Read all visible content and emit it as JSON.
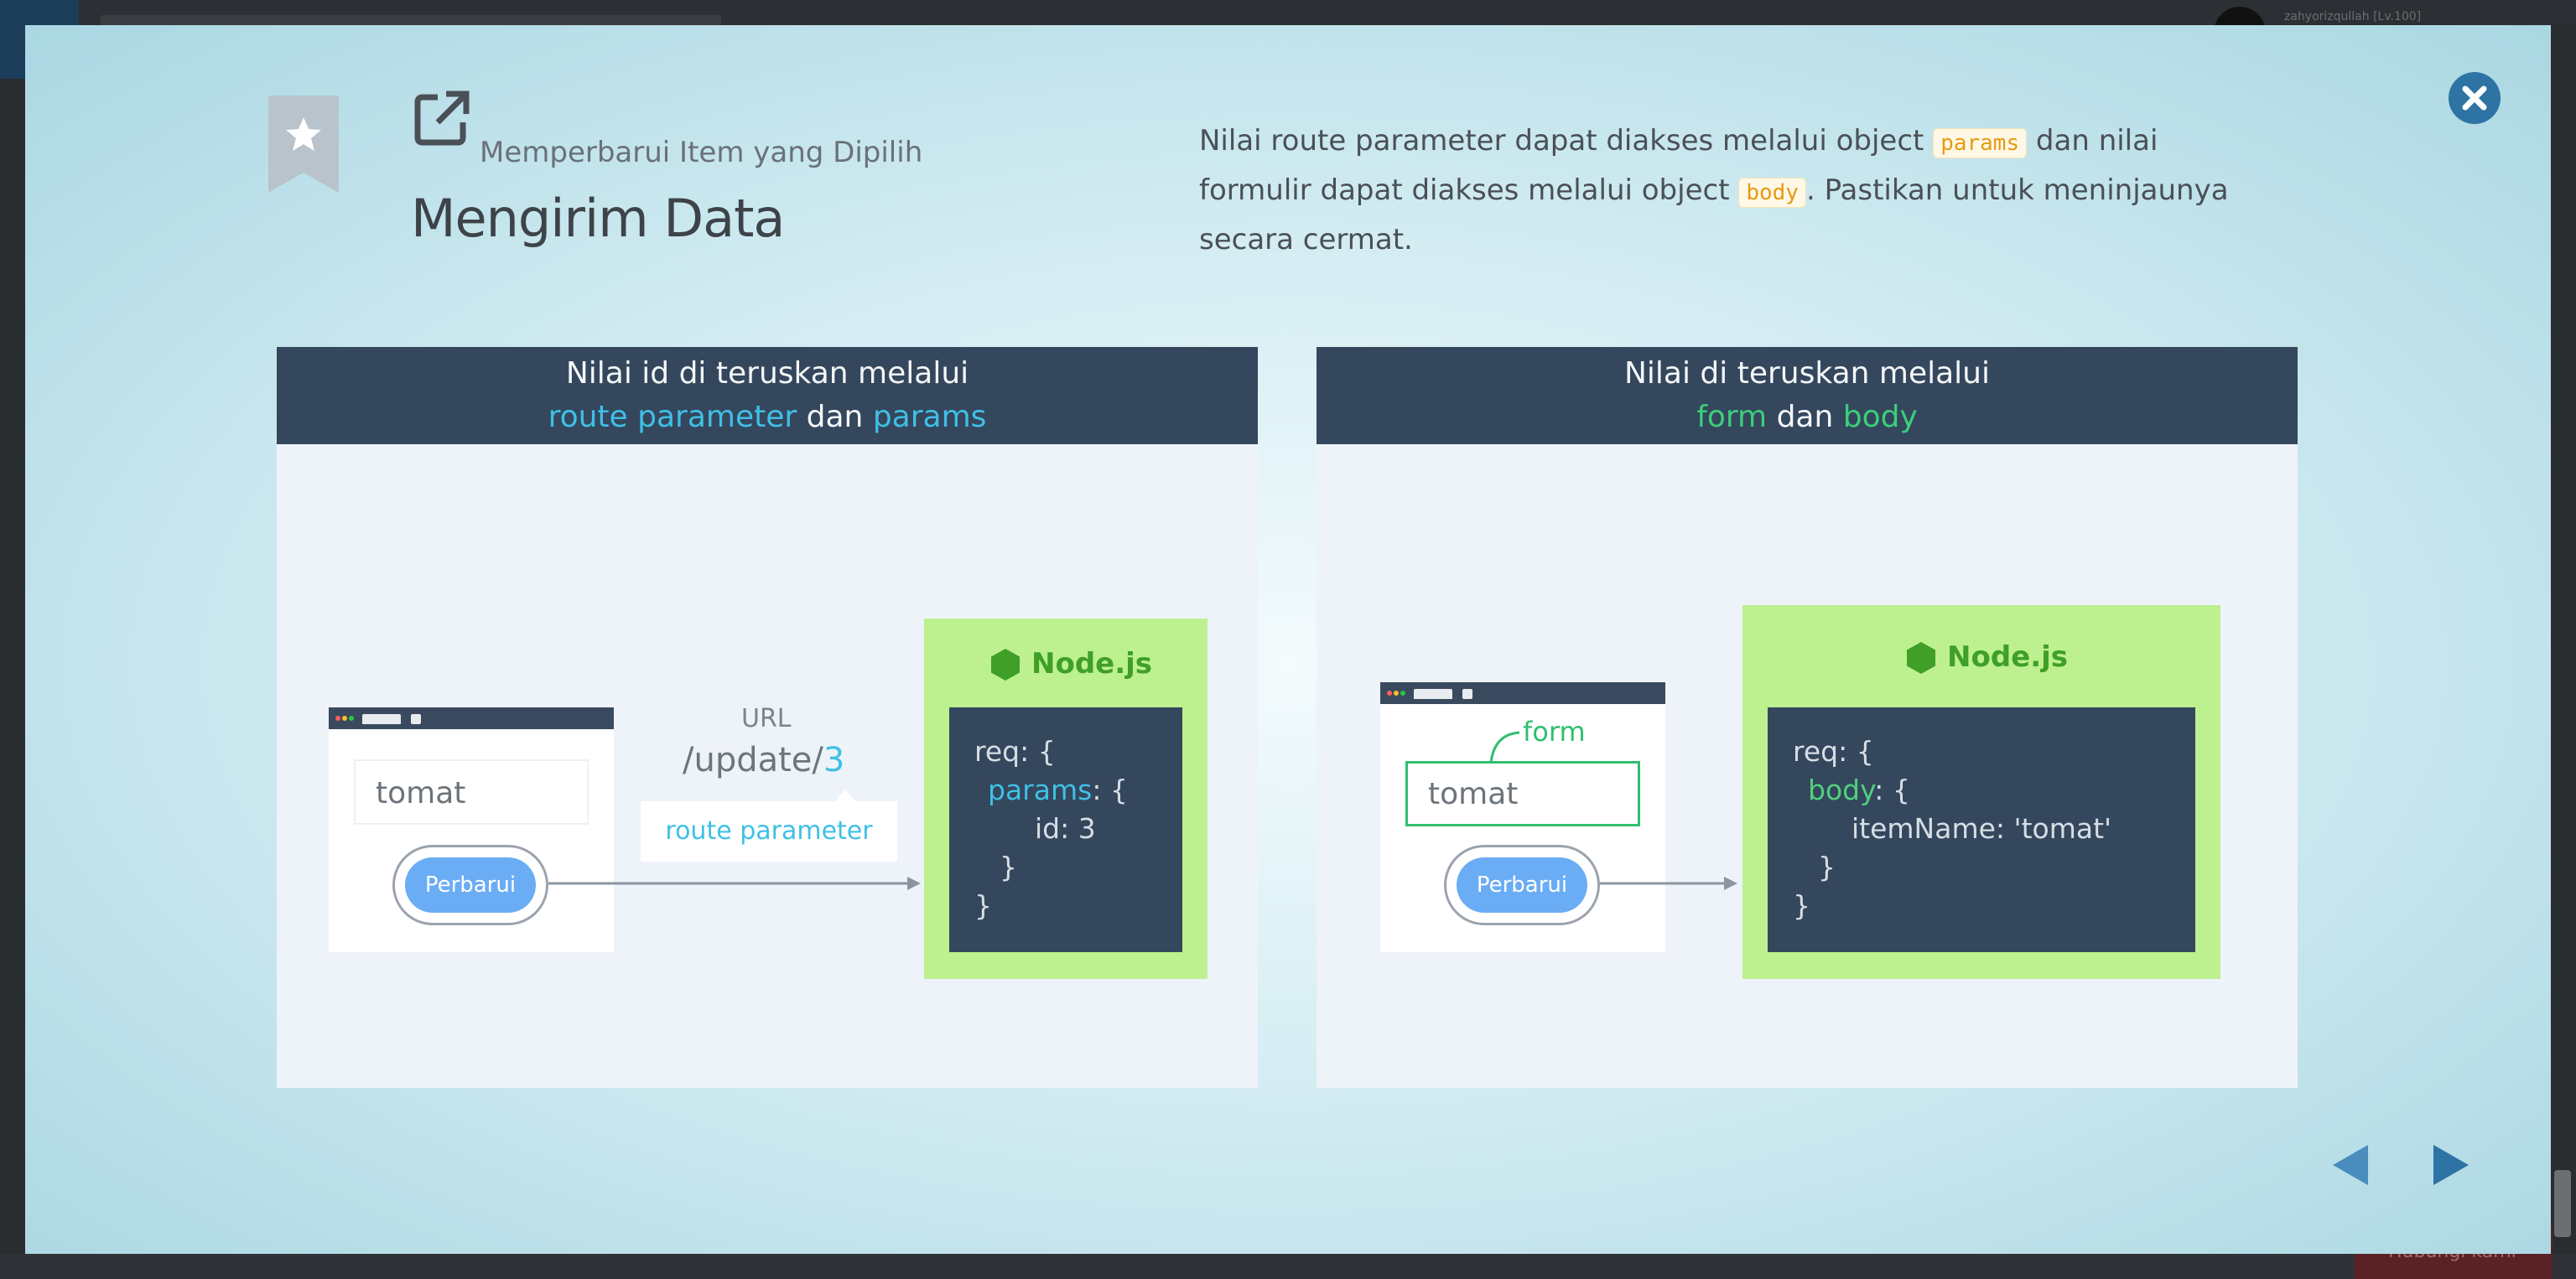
{
  "background_app": {
    "user_label": "zahyorizqullah [Lv.100]",
    "bottom_button": "Hubungi kami"
  },
  "modal": {
    "subtitle": "Memperbarui Item yang Dipilih",
    "title": "Mengirim Data",
    "description": {
      "part1": "Nilai route parameter dapat diakses melalui object ",
      "code1": "params",
      "part2": " dan nilai formulir dapat diakses melalui object ",
      "code2": "body",
      "part3": ". Pastikan untuk meninjaunya secara cermat."
    },
    "close_icon": "close-icon",
    "nav": {
      "prev_icon": "triangle-left-icon",
      "next_icon": "triangle-right-icon"
    }
  },
  "panel_left": {
    "heading_line1": "Nilai id di teruskan melalui",
    "heading_hl1": "route parameter",
    "heading_mid": " dan ",
    "heading_hl2": "params",
    "input_value": "tomat",
    "button_label": "Perbarui",
    "url_label": "URL",
    "url_path": "/update/",
    "url_id": "3",
    "route_tip": "route parameter",
    "node_label": "Node.js",
    "code": {
      "l1": "req: {",
      "l2_key": "params",
      "l2_rest": ": {",
      "l3": "id: 3",
      "l4": "}",
      "l5": "}"
    }
  },
  "panel_right": {
    "heading_line1": "Nilai di teruskan melalui",
    "heading_hl1": "form",
    "heading_mid": " dan ",
    "heading_hl2": "body",
    "form_tag": "form",
    "input_value": "tomat",
    "button_label": "Perbarui",
    "node_label": "Node.js",
    "code": {
      "l1": "req: {",
      "l2_key": "body",
      "l2_rest": ": {",
      "l3": "itemName: 'tomat'",
      "l4": "}",
      "l5": "}"
    }
  },
  "colors": {
    "accent_blue": "#3fc0e6",
    "accent_green": "#3ccf7a",
    "panel_header": "#34475d",
    "node_green": "#bdf08f",
    "button_blue": "#6aadf4",
    "close_blue": "#2d73a3"
  }
}
